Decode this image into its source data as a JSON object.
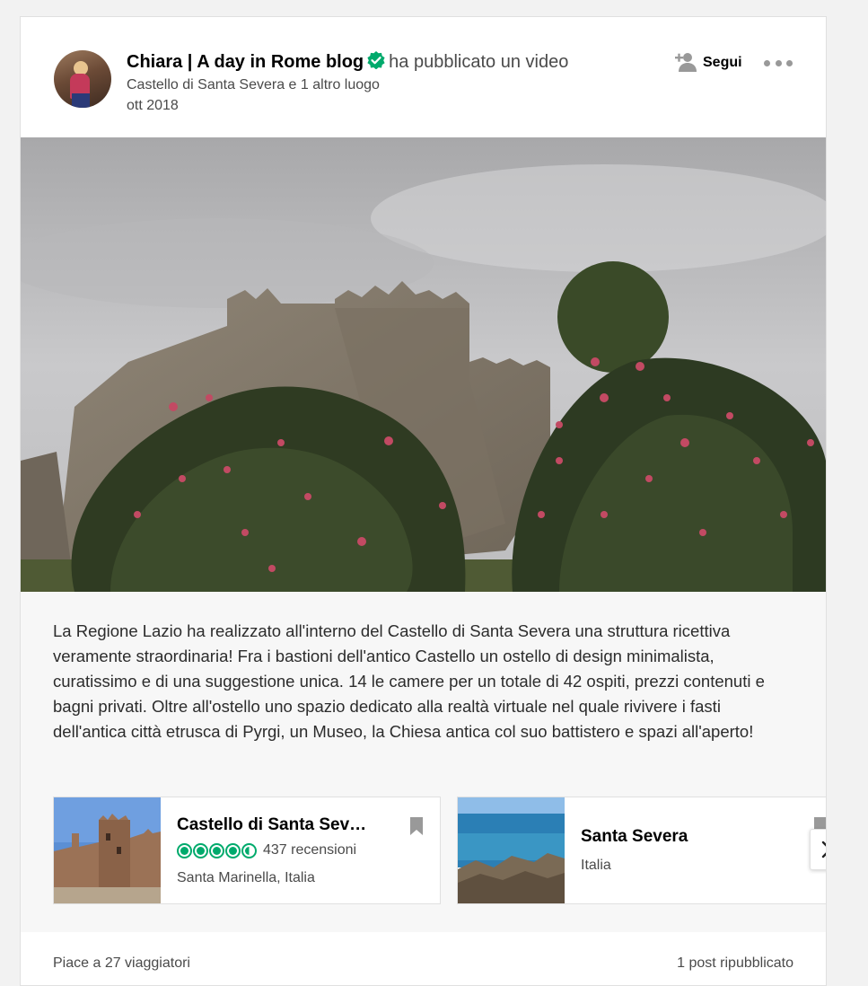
{
  "post": {
    "author": "Chiara | A day in Rome blog",
    "action": "ha pubblicato un video",
    "location": "Castello di Santa Severa e 1 altro luogo",
    "date": "ott 2018",
    "follow_label": "Segui",
    "verified_icon": "verified-check-icon",
    "accent_color": "#00aa6c"
  },
  "description": "La Regione Lazio ha realizzato all'interno del Castello di Santa Severa una struttura ricettiva veramente straordinaria! Fra i bastioni dell'antico Castello un ostello di design minimalista, curatissimo e di una suggestione unica. 14 le camere per un totale di 42 ospiti, prezzi contenuti e bagni privati. Oltre all'ostello uno spazio dedicato alla realtà virtuale nel quale rivivere i fasti dell'antica città etrusca di Pyrgi, un Museo, la Chiesa antica col suo battistero e spazi all'aperto!",
  "places": [
    {
      "title": "Castello di Santa Sev…",
      "rating": 4.5,
      "reviews": "437 recensioni",
      "subtitle": "Santa Marinella, Italia"
    },
    {
      "title": "Santa Severa",
      "subtitle": "Italia"
    }
  ],
  "footer": {
    "likes": "Piace a 27 viaggiatori",
    "reposts": "1 post ripubblicato"
  }
}
